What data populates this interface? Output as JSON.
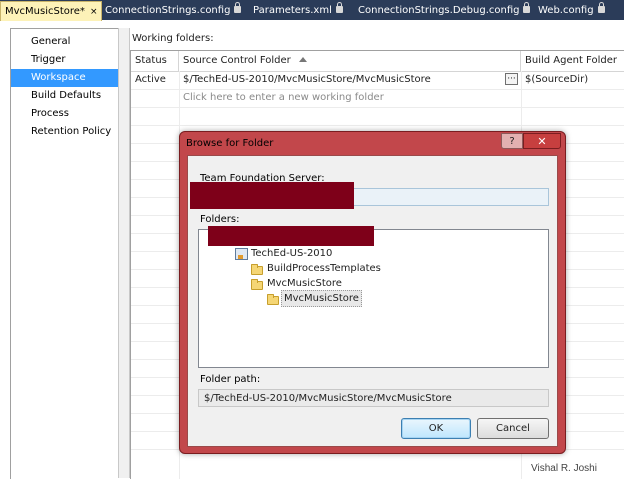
{
  "tabs": [
    {
      "label": "MvcMusicStore*",
      "close": "×",
      "active": true
    },
    {
      "label": "ConnectionStrings.config",
      "locked": true
    },
    {
      "label": "Parameters.xml",
      "locked": true
    },
    {
      "label": "ConnectionStrings.Debug.config",
      "locked": true
    },
    {
      "label": "Web.config",
      "locked": true
    }
  ],
  "sidebar": {
    "items": [
      {
        "label": "General"
      },
      {
        "label": "Trigger"
      },
      {
        "label": "Workspace",
        "selected": true
      },
      {
        "label": "Build Defaults"
      },
      {
        "label": "Process"
      },
      {
        "label": "Retention Policy"
      }
    ]
  },
  "workspace": {
    "title": "Working folders:",
    "columns": {
      "status": "Status",
      "source": "Source Control Folder",
      "agent": "Build Agent Folder"
    },
    "row1": {
      "status": "Active",
      "source": "$/TechEd-US-2010/MvcMusicStore/MvcMusicStore",
      "ellipsis": "···",
      "agent": "$(SourceDir)"
    },
    "hint": "Click here to enter a new working folder"
  },
  "dialog": {
    "title": "Browse for Folder",
    "help": "?",
    "close": "✕",
    "server_label": "Team Foundation Server:",
    "folders_label": "Folders:",
    "tree": {
      "root": "TechEd-US-2010",
      "children": [
        "BuildProcessTemplates",
        "MvcMusicStore"
      ],
      "grandchild": "MvcMusicStore"
    },
    "path_label": "Folder path:",
    "path_value": "$/TechEd-US-2010/MvcMusicStore/MvcMusicStore",
    "ok": "OK",
    "cancel": "Cancel"
  },
  "watermark": "Vishal R. Joshi",
  "colors": {
    "selection": "#3399ff",
    "dialog_frame": "#c2474b",
    "redaction": "#7e0019",
    "tabstrip": "#2b3c59"
  }
}
